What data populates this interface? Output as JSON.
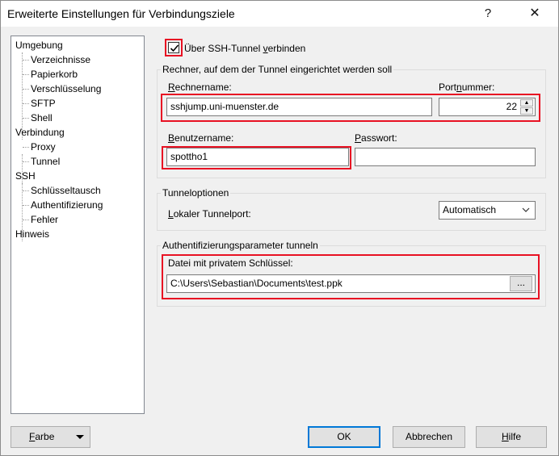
{
  "window": {
    "title": "Erweiterte Einstellungen für Verbindungsziele",
    "help_glyph": "?",
    "close_glyph": "✕"
  },
  "tree": {
    "items": [
      {
        "label": "Umgebung",
        "level": 0
      },
      {
        "label": "Verzeichnisse",
        "level": 1
      },
      {
        "label": "Papierkorb",
        "level": 1
      },
      {
        "label": "Verschlüsselung",
        "level": 1
      },
      {
        "label": "SFTP",
        "level": 1
      },
      {
        "label": "Shell",
        "level": 1
      },
      {
        "label": "Verbindung",
        "level": 0
      },
      {
        "label": "Proxy",
        "level": 1
      },
      {
        "label": "Tunnel",
        "level": 1,
        "selected": true
      },
      {
        "label": "SSH",
        "level": 0
      },
      {
        "label": "Schlüsseltausch",
        "level": 1
      },
      {
        "label": "Authentifizierung",
        "level": 1
      },
      {
        "label": "Fehler",
        "level": 1
      },
      {
        "label": "Hinweis",
        "level": 0
      }
    ]
  },
  "tunnel": {
    "checkbox_label_pre": "Über SSH-Tunnel ",
    "checkbox_label_u": "v",
    "checkbox_label_post": "erbinden",
    "checked": true
  },
  "host_group": {
    "title": "Rechner, auf dem der Tunnel eingerichtet werden soll",
    "hostname_label_u": "R",
    "hostname_label_rest": "echnername:",
    "hostname_value": "sshjump.uni-muenster.de",
    "port_label_pre": "Port",
    "port_label_u": "n",
    "port_label_post": "ummer:",
    "port_value": "22",
    "username_label_u": "B",
    "username_label_rest": "enutzername:",
    "username_value": "spottho1",
    "password_label_u": "P",
    "password_label_rest": "asswort:",
    "password_value": ""
  },
  "tunnel_options": {
    "title": "Tunneloptionen",
    "local_port_label_u": "L",
    "local_port_label_rest": "okaler Tunnelport:",
    "local_port_value": "Automatisch"
  },
  "auth_group": {
    "title": "Authentifizierungsparameter tunneln",
    "key_label": "Datei mit privatem Schlüssel:",
    "key_value": "C:\\Users\\Sebastian\\Documents\\test.ppk",
    "browse_label": "..."
  },
  "buttons": {
    "color_u": "F",
    "color_rest": "arbe",
    "ok": "OK",
    "cancel": "Abbrechen",
    "help_u": "H",
    "help_rest": "ilfe"
  },
  "colors": {
    "highlight": "#e81123",
    "default_button_border": "#0078d7"
  }
}
